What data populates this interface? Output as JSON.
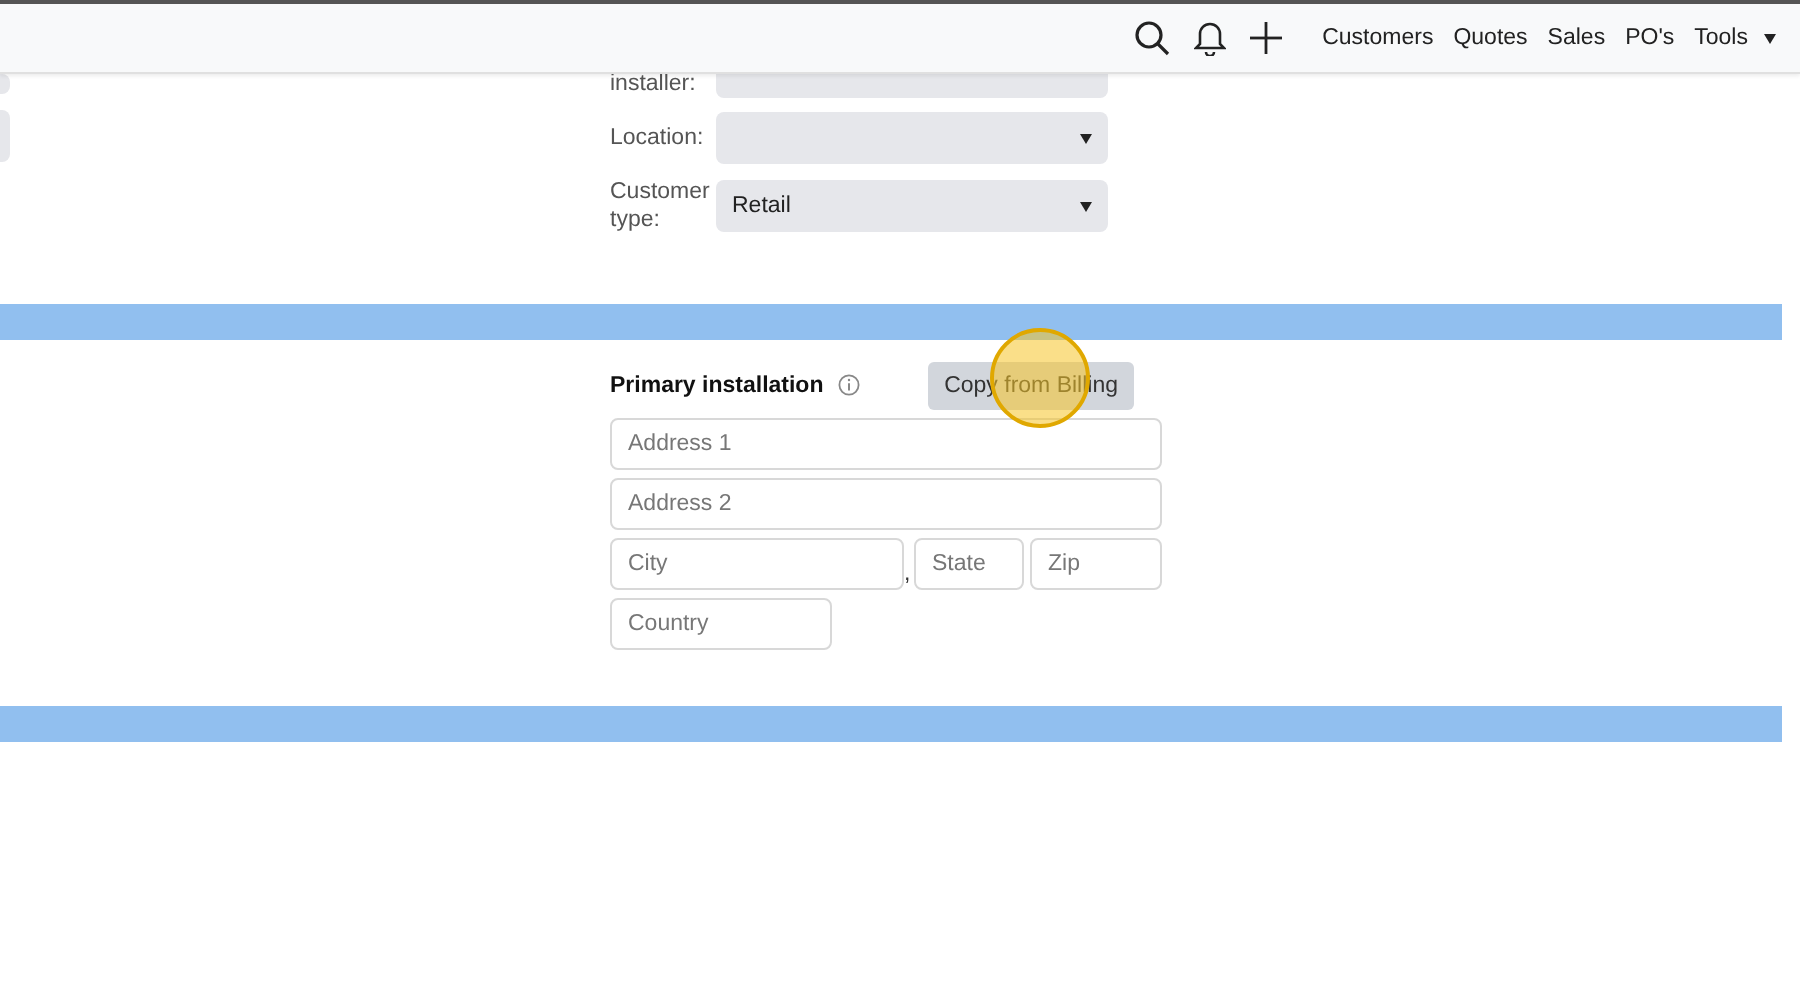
{
  "nav": {
    "items": [
      {
        "label": "Customers"
      },
      {
        "label": "Quotes"
      },
      {
        "label": "Sales"
      },
      {
        "label": "PO's"
      },
      {
        "label": "Tools",
        "dropdown": true
      }
    ]
  },
  "details": {
    "fields": [
      {
        "label": "installer:",
        "kind": "text"
      },
      {
        "label": "Location:",
        "kind": "select"
      },
      {
        "label": "Customer type:",
        "kind": "select",
        "value": "Retail"
      }
    ]
  },
  "installation": {
    "title": "Primary installation",
    "button": "Copy from Billing",
    "address1": {
      "placeholder": "Address 1"
    },
    "address2": {
      "placeholder": "Address 2"
    },
    "city": {
      "placeholder": "City"
    },
    "separator": ",",
    "state": {
      "placeholder": "State"
    },
    "zip": {
      "placeholder": "Zip"
    },
    "country": {
      "placeholder": "Country"
    }
  }
}
